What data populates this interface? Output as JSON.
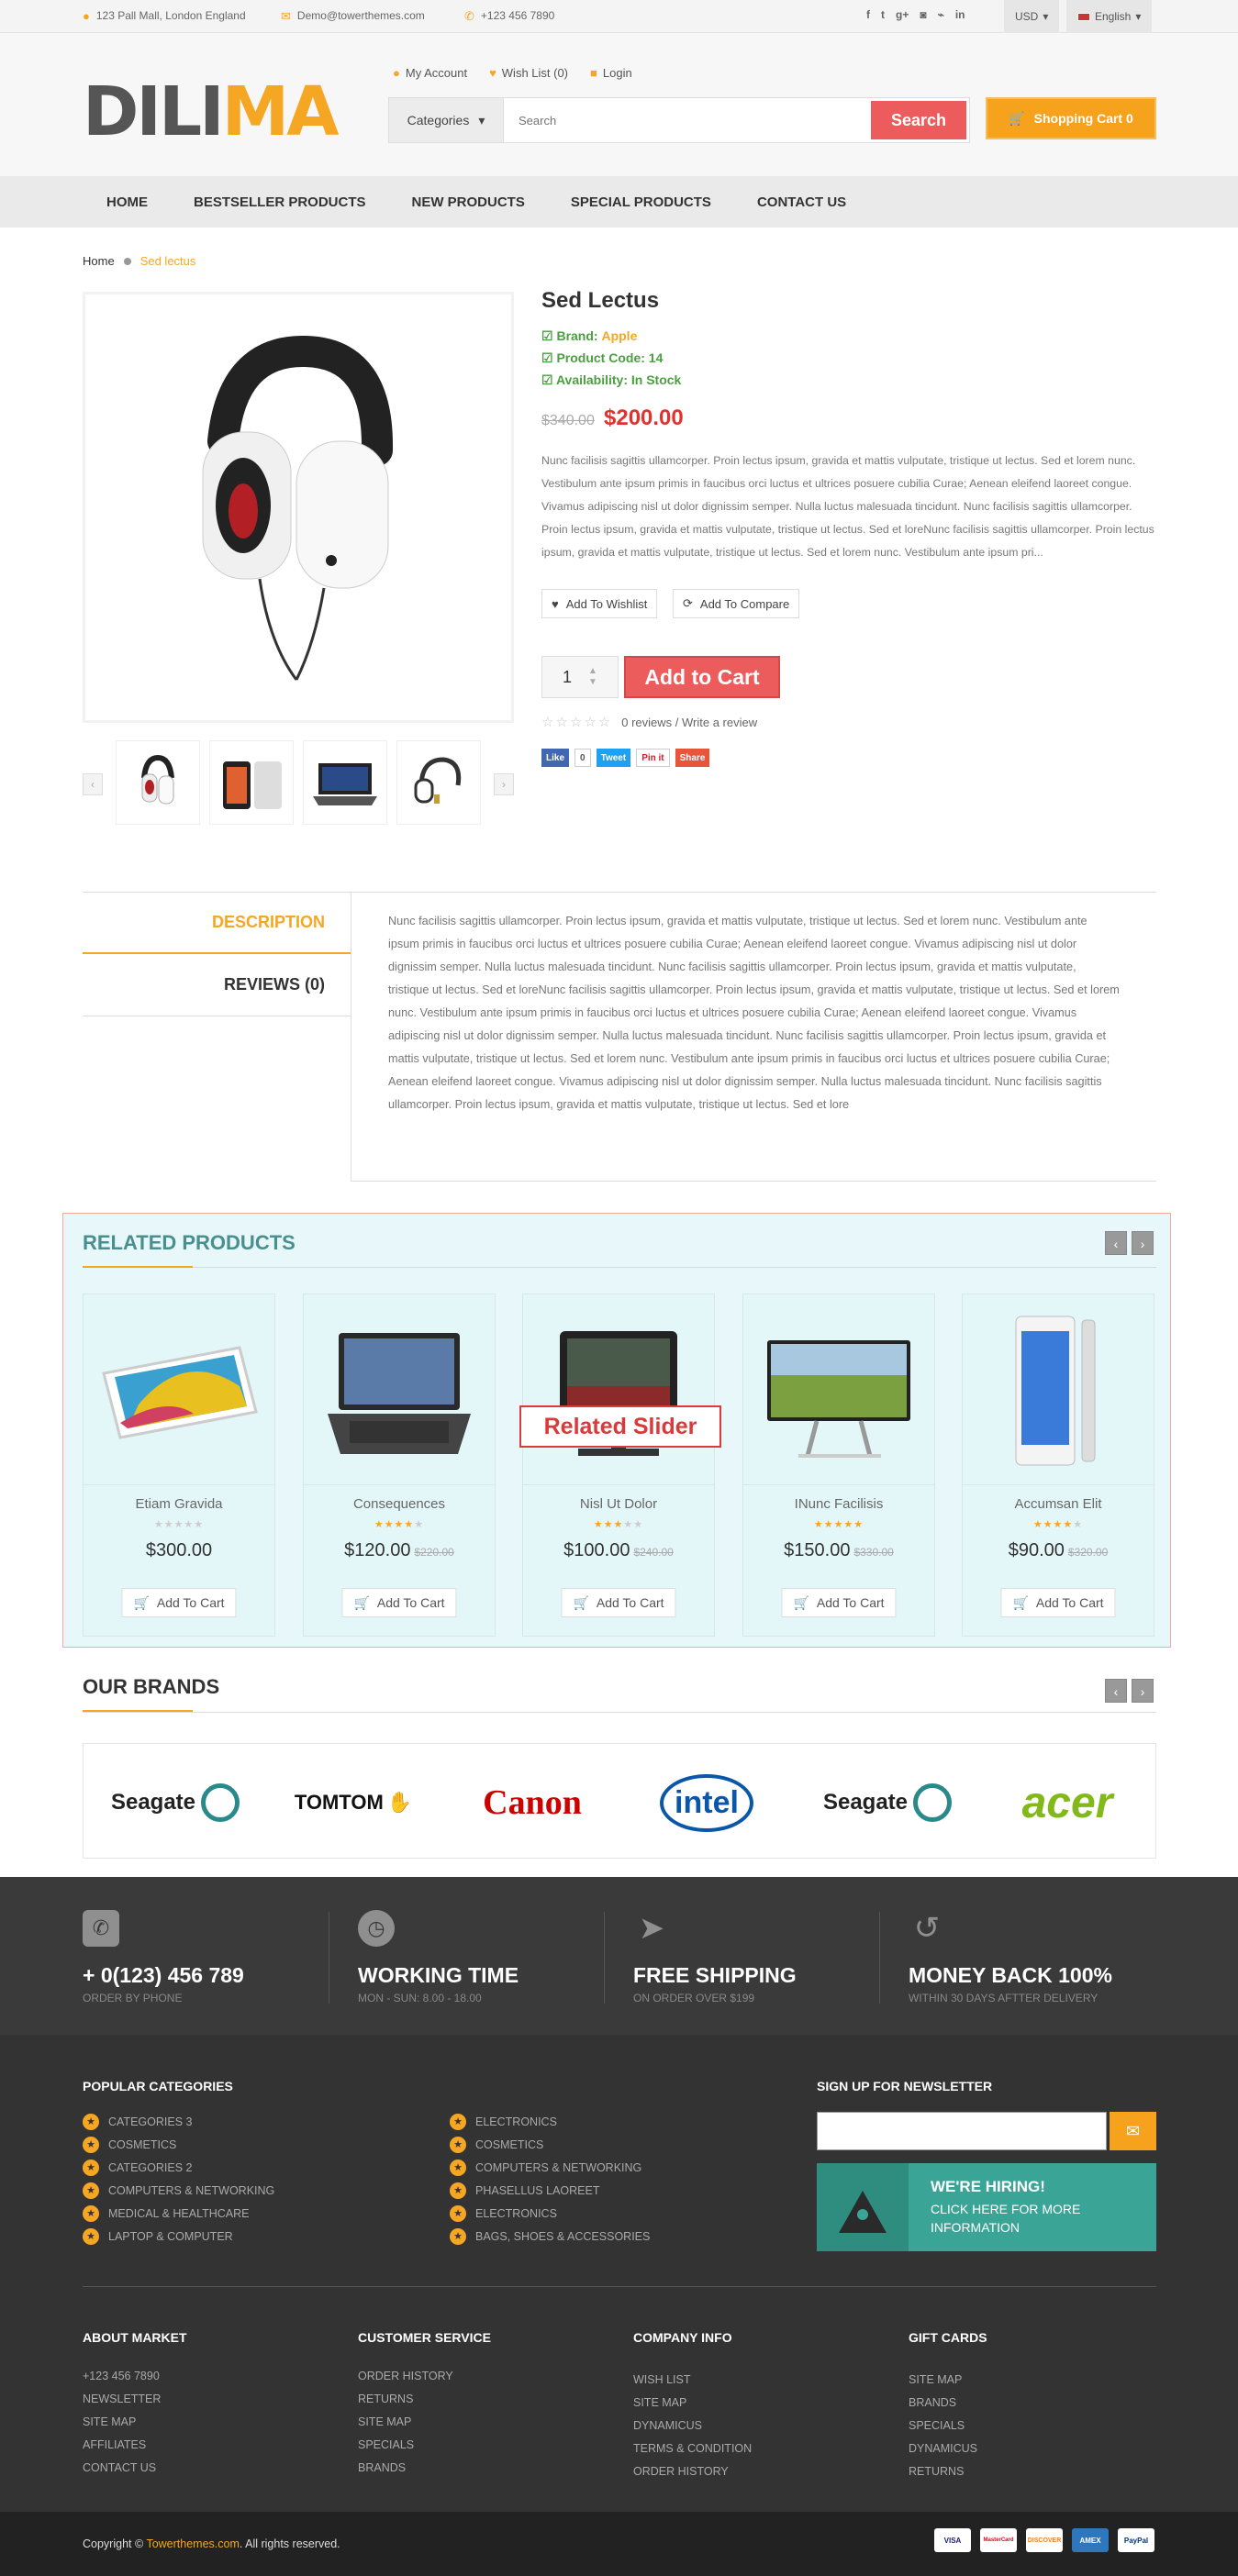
{
  "topbar": {
    "address": "123 Pall Mall, London England",
    "email": "Demo@towerthemes.com",
    "phone": "+123 456 7890",
    "currency": "USD",
    "language": "English",
    "social_icons": [
      "facebook-icon",
      "twitter-icon",
      "google-plus-icon",
      "instagram-icon",
      "rss-icon",
      "linkedin-icon"
    ]
  },
  "header": {
    "logo_part1": "DILI",
    "logo_part2": "MA",
    "my_account": "My Account",
    "wishlist": "Wish List (0)",
    "login": "Login",
    "category_label": "Categories",
    "search_placeholder": "Search",
    "search_button": "Search",
    "cart": "Shopping Cart 0"
  },
  "nav": [
    "HOME",
    "BESTSELLER PRODUCTS",
    "NEW PRODUCTS",
    "SPECIAL PRODUCTS",
    "CONTACT US"
  ],
  "breadcrumb": {
    "home": "Home",
    "current": "Sed lectus"
  },
  "product": {
    "title": "Sed Lectus",
    "brand_label": "Brand:",
    "brand": "Apple",
    "code_label": "Product Code:",
    "code": "14",
    "avail_label": "Availability:",
    "availability": "In Stock",
    "old_price": "$340.00",
    "price": "$200.00",
    "description": "Nunc facilisis sagittis ullamcorper. Proin lectus ipsum, gravida et mattis vulputate, tristique ut lectus. Sed et lorem nunc. Vestibulum ante ipsum primis in faucibus orci luctus et ultrices posuere cubilia Curae; Aenean eleifend laoreet congue. Vivamus adipiscing nisl ut dolor dignissim semper. Nulla luctus malesuada tincidunt. Nunc facilisis sagittis ullamcorper. Proin lectus ipsum, gravida et mattis vulputate, tristique ut lectus. Sed et loreNunc facilisis sagittis ullamcorper. Proin lectus ipsum, gravida et mattis vulputate, tristique ut lectus. Sed et lorem nunc. Vestibulum ante ipsum pri...",
    "wishlist_btn": "Add To Wishlist",
    "compare_btn": "Add To Compare",
    "qty": "1",
    "add_to_cart": "Add to Cart",
    "reviews": "0 reviews / Write a review",
    "share": {
      "like": "Like",
      "like_count": "0",
      "tweet": "Tweet",
      "pin": "Pin it",
      "share": "Share"
    }
  },
  "tabs": {
    "description": "DESCRIPTION",
    "reviews": "REVIEWS (0)",
    "content": "Nunc facilisis sagittis ullamcorper. Proin lectus ipsum, gravida et mattis vulputate, tristique ut lectus. Sed et lorem nunc. Vestibulum ante ipsum primis in faucibus orci luctus et ultrices posuere cubilia Curae; Aenean eleifend laoreet congue. Vivamus adipiscing nisl ut dolor dignissim semper. Nulla luctus malesuada tincidunt. Nunc facilisis sagittis ullamcorper. Proin lectus ipsum, gravida et mattis vulputate, tristique ut lectus. Sed et loreNunc facilisis sagittis ullamcorper. Proin lectus ipsum, gravida et mattis vulputate, tristique ut lectus. Sed et lorem nunc. Vestibulum ante ipsum primis in faucibus orci luctus et ultrices posuere cubilia Curae; Aenean eleifend laoreet congue. Vivamus adipiscing nisl ut dolor dignissim semper. Nulla luctus malesuada tincidunt. Nunc facilisis sagittis ullamcorper. Proin lectus ipsum, gravida et mattis vulputate, tristique ut lectus. Sed et lorem nunc. Vestibulum ante ipsum primis in faucibus orci luctus et ultrices posuere cubilia Curae; Aenean eleifend laoreet congue. Vivamus adipiscing nisl ut dolor dignissim semper. Nulla luctus malesuada tincidunt. Nunc facilisis sagittis ullamcorper. Proin lectus ipsum, gravida et mattis vulputate, tristique ut lectus. Sed et lore"
  },
  "related": {
    "title": "RELATED PRODUCTS",
    "overlay_label": "Related Slider",
    "items": [
      {
        "name": "Etiam Gravida",
        "price": "$300.00",
        "old": "",
        "stars": 0,
        "btn": "Add To Cart"
      },
      {
        "name": "Consequences",
        "price": "$120.00",
        "old": "$220.00",
        "stars": 4,
        "btn": "Add To Cart"
      },
      {
        "name": "Nisl Ut Dolor",
        "price": "$100.00",
        "old": "$240.00",
        "stars": 3,
        "btn": "Add To Cart"
      },
      {
        "name": "INunc Facilisis",
        "price": "$150.00",
        "old": "$330.00",
        "stars": 5,
        "btn": "Add To Cart"
      },
      {
        "name": "Accumsan Elit",
        "price": "$90.00",
        "old": "$320.00",
        "stars": 4,
        "btn": "Add To Cart"
      }
    ]
  },
  "brands": {
    "title": "OUR BRANDS",
    "items": [
      "Seagate",
      "TOMTOM",
      "Canon",
      "intel",
      "Seagate",
      "acer"
    ]
  },
  "features": [
    {
      "title": "+ 0(123) 456 789",
      "sub": "ORDER BY PHONE",
      "icon": "phone-icon"
    },
    {
      "title": "WORKING TIME",
      "sub": "MON - SUN: 8.00 - 18.00",
      "icon": "clock-icon"
    },
    {
      "title": "FREE SHIPPING",
      "sub": "ON ORDER OVER $199",
      "icon": "paper-plane-icon"
    },
    {
      "title": "MONEY BACK 100%",
      "sub": "WITHIN 30 DAYS AFTTER DELIVERY",
      "icon": "refresh-icon"
    }
  ],
  "footer": {
    "popular_title": "POPULAR CATEGORIES",
    "popular_col1": [
      "CATEGORIES 3",
      "COSMETICS",
      "CATEGORIES 2",
      "COMPUTERS & NETWORKING",
      "MEDICAL & HEALTHCARE",
      "LAPTOP & COMPUTER"
    ],
    "popular_col2": [
      "ELECTRONICS",
      "COSMETICS",
      "COMPUTERS & NETWORKING",
      "PHASELLUS LAOREET",
      "ELECTRONICS",
      "BAGS, SHOES & ACCESSORIES"
    ],
    "newsletter_title": "SIGN UP FOR NEWSLETTER",
    "hiring_title": "WE'RE HIRING!",
    "hiring_sub": "CLICK HERE FOR MORE INFORMATION",
    "about_title": "ABOUT MARKET",
    "about": [
      "+123 456 7890",
      "NEWSLETTER",
      "SITE MAP",
      "AFFILIATES",
      "CONTACT US"
    ],
    "service_title": "CUSTOMER SERVICE",
    "service": [
      "ORDER HISTORY",
      "RETURNS",
      "SITE MAP",
      "SPECIALS",
      "BRANDS"
    ],
    "company_title": "COMPANY INFO",
    "company": [
      "WISH LIST",
      "SITE MAP",
      "DYNAMICUS",
      "TERMS & CONDITION",
      "ORDER HISTORY"
    ],
    "gift_title": "GIFT CARDS",
    "gift": [
      "SITE MAP",
      "BRANDS",
      "SPECIALS",
      "DYNAMICUS",
      "RETURNS"
    ]
  },
  "copyright": {
    "prefix": "Copyright ©",
    "link": "Towerthemes.com",
    "suffix": ". All rights reserved."
  },
  "payments": [
    "VISA",
    "MasterCard",
    "DISCOVER",
    "AMEX",
    "PayPal"
  ],
  "colors": {
    "accent": "#f5a623",
    "red": "#ec5c5c",
    "green": "#4a9f3e",
    "teal": "#3aa596",
    "dark": "#333333"
  }
}
